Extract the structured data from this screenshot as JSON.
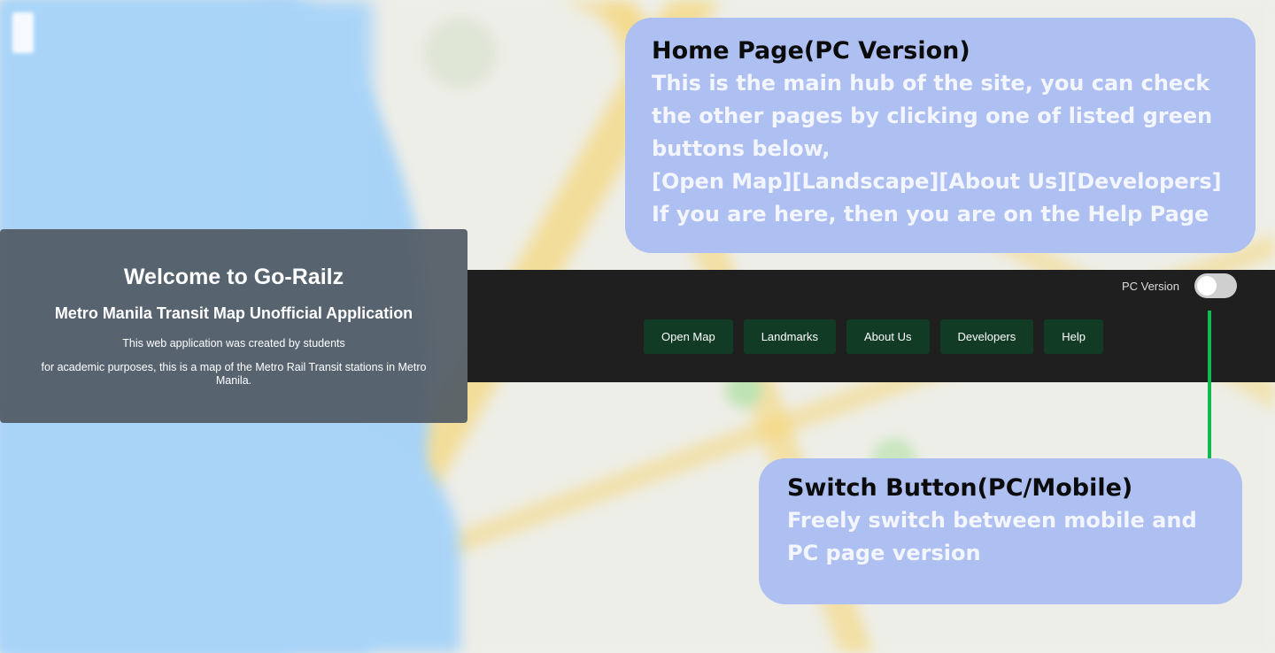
{
  "welcome": {
    "title": "Welcome to Go-Railz",
    "subtitle": "Metro Manila Transit Map Unofficial Application",
    "line1": "This web application was created by students",
    "line2": "for academic purposes, this is a map of the Metro Rail Transit stations in Metro Manila."
  },
  "navbar": {
    "toggle_label": "PC Version",
    "toggle_on": false,
    "buttons": [
      "Open Map",
      "Landmarks",
      "About Us",
      "Developers",
      "Help"
    ]
  },
  "help_callouts": {
    "home": {
      "title": "Home Page(PC Version)",
      "lines": [
        "This is the main hub of the site, you can check the other pages by clicking one of listed green buttons below,",
        "[Open Map][Landscape][About Us][Developers]",
        "If you are here, then you are on the Help Page"
      ]
    },
    "switch": {
      "title": "Switch Button(PC/Mobile)",
      "body": "Freely switch between mobile and PC page version"
    }
  },
  "colors": {
    "callout_bg": "#aebff2",
    "nav_button_bg": "#113b25",
    "navbar_bg": "#1f1f1f",
    "connector": "#0fba4e"
  }
}
